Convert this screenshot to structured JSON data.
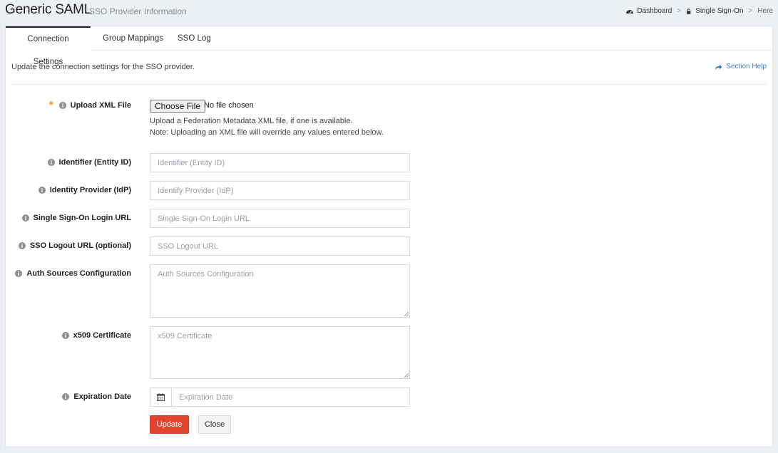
{
  "header": {
    "title": "Generic SAML",
    "subtitle": "SSO Provider Information",
    "breadcrumb": [
      {
        "label": "Dashboard",
        "icon": "dashboard-icon"
      },
      {
        "label": "Single Sign-On",
        "icon": "lock-icon"
      },
      {
        "label": "Here"
      }
    ]
  },
  "tabs": [
    {
      "label": "Connection Settings",
      "active": true
    },
    {
      "label": "Group Mappings",
      "active": false
    },
    {
      "label": "SSO Log",
      "active": false
    }
  ],
  "intro_text": "Update the connection settings for the SSO provider.",
  "section_help": {
    "label": "Section Help",
    "icon": "share-arrow-icon"
  },
  "form": {
    "upload": {
      "label": "Upload XML File",
      "required": true,
      "button_label": "Choose File",
      "status": "No file chosen",
      "hint_1": "Upload a Federation Metadata XML file, if one is available.",
      "hint_2": "Note: Uploading an XML file will override any values entered below."
    },
    "entity_id": {
      "label": "Identifier (Entity ID)",
      "placeholder": "Identifier (Entity ID)",
      "value": ""
    },
    "idp": {
      "label": "Identity Provider (IdP)",
      "placeholder": "Identify Provider (IdP)",
      "value": ""
    },
    "login_url": {
      "label": "Single Sign-On Login URL",
      "placeholder": "Single Sign-On Login URL",
      "value": ""
    },
    "logout_url": {
      "label": "SSO Logout URL (optional)",
      "placeholder": "SSO Logout URL",
      "value": ""
    },
    "auth_sources": {
      "label": "Auth Sources Configuration",
      "placeholder": "Auth Sources Configuration",
      "value": ""
    },
    "x509": {
      "label": "x509 Certificate",
      "placeholder": "x509 Certificate",
      "value": ""
    },
    "expiration": {
      "label": "Expiration Date",
      "placeholder": "Expiration Date",
      "value": "",
      "icon": "calendar-icon"
    }
  },
  "buttons": {
    "update": "Update",
    "close": "Close"
  },
  "colors": {
    "primary_button": "#e0442f",
    "link": "#3a7bbf",
    "required": "#e8961e"
  }
}
